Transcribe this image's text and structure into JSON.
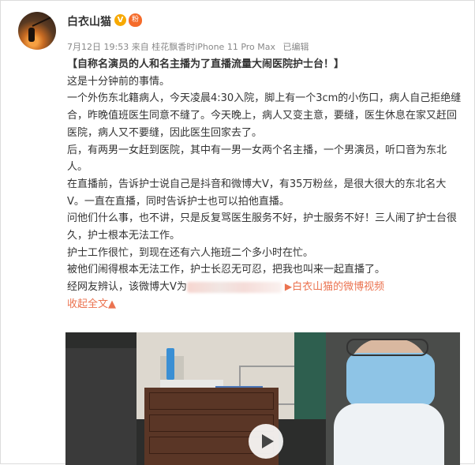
{
  "post": {
    "author": "白衣山猫",
    "verified_badge": "V",
    "fan_badge": "粉",
    "meta": {
      "time": "7月12日 19:53",
      "source": "来自 桂花飘香时iPhone 11 Pro Max",
      "edited": "已编辑"
    },
    "paragraphs": [
      "【自称名演员的人和名主播为了直播流量大闹医院护士台！】",
      "这是十分钟前的事情。",
      "一个外伤东北籍病人，今天凌晨4:30入院，脚上有一个3cm的小伤口，病人自己拒绝缝合，昨晚值班医生同意不缝了。今天晚上，病人又变主意，要缝，医生休息在家又赶回医院，病人又不要缝，因此医生回家去了。",
      "后，有两男一女赶到医院，其中有一男一女两个名主播，一个男演员，听口音为东北人。",
      "在直播前，告诉护士说自己是抖音和微博大V，有35万粉丝，是很大很大的东北名大V。一直在直播，同时告诉护士也可以拍他直播。",
      "问他们什么事，也不讲，只是反复骂医生服务不好，护士服务不好！三人闹了护士台很久，护士根本无法工作。",
      "护士工作很忙，到现在还有六人拖班二个多小时在忙。",
      "被他们闹得根本无法工作，护士长忍无可忍，把我也叫来一起直播了。"
    ],
    "last_line_prefix": "经网友辨认，该微博大V为",
    "link_icon": "video-link-icon",
    "link_text": "白衣山猫的微博视频",
    "collapse_label": "收起全文",
    "collapse_arrow": "▲",
    "accent_color": "#eb7350"
  }
}
